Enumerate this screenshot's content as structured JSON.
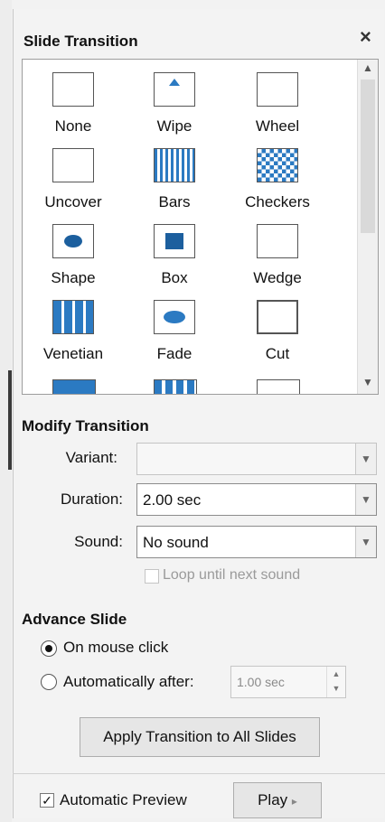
{
  "panel": {
    "title": "Slide Transition",
    "close_glyph": "×"
  },
  "transitions": [
    {
      "label": "None",
      "icon": "none-transition-icon"
    },
    {
      "label": "Wipe",
      "icon": "wipe-transition-icon"
    },
    {
      "label": "Wheel",
      "icon": "wheel-transition-icon"
    },
    {
      "label": "Uncover",
      "icon": "uncover-transition-icon"
    },
    {
      "label": "Bars",
      "icon": "bars-transition-icon"
    },
    {
      "label": "Checkers",
      "icon": "checkers-transition-icon"
    },
    {
      "label": "Shape",
      "icon": "shape-transition-icon"
    },
    {
      "label": "Box",
      "icon": "box-transition-icon"
    },
    {
      "label": "Wedge",
      "icon": "wedge-transition-icon"
    },
    {
      "label": "Venetian",
      "icon": "venetian-transition-icon"
    },
    {
      "label": "Fade",
      "icon": "fade-transition-icon"
    },
    {
      "label": "Cut",
      "icon": "cut-transition-icon"
    }
  ],
  "modify": {
    "heading": "Modify Transition",
    "variant_label": "Variant:",
    "variant_value": "",
    "duration_label": "Duration:",
    "duration_value": "2.00 sec",
    "sound_label": "Sound:",
    "sound_value": "No sound",
    "loop_label": "Loop until next sound"
  },
  "advance": {
    "heading": "Advance Slide",
    "on_click_label": "On mouse click",
    "auto_label": "Automatically after:",
    "auto_value": "1.00 sec",
    "apply_all_label": "Apply Transition to All Slides"
  },
  "footer": {
    "auto_preview_label": "Automatic Preview",
    "play_label": "Play"
  },
  "colors": {
    "accent": "#2b7ac2",
    "panel_bg": "#f3f3f3"
  }
}
